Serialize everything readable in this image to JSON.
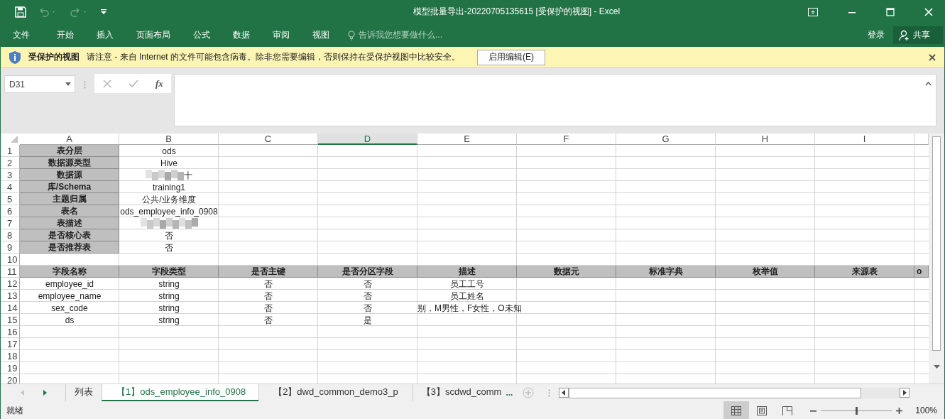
{
  "window": {
    "title": "模型批量导出-20220705135615  [受保护的视图] - Excel"
  },
  "ribbon": {
    "tabs": [
      {
        "label": "文件",
        "selected": false
      },
      {
        "label": "开始",
        "selected": false
      },
      {
        "label": "插入",
        "selected": false
      },
      {
        "label": "页面布局",
        "selected": false
      },
      {
        "label": "公式",
        "selected": false
      },
      {
        "label": "数据",
        "selected": false
      },
      {
        "label": "审阅",
        "selected": false
      },
      {
        "label": "视图",
        "selected": false
      }
    ],
    "tell_me": {
      "placeholder": "告诉我您想要做什么..."
    },
    "sign_in": "登录",
    "share": "共享"
  },
  "protected_bar": {
    "title": "受保护的视图",
    "message": "请注意 - 来自 Internet 的文件可能包含病毒。除非您需要编辑，否则保持在受保护视图中比较安全。",
    "button": "启用编辑(E)"
  },
  "formula_bar": {
    "name_box": "D31",
    "function_label": "fx"
  },
  "sheet": {
    "columns": [
      {
        "label": "A",
        "selected": false
      },
      {
        "label": "B",
        "selected": false
      },
      {
        "label": "C",
        "selected": false
      },
      {
        "label": "D",
        "selected": true
      },
      {
        "label": "E",
        "selected": false
      },
      {
        "label": "F",
        "selected": false
      },
      {
        "label": "G",
        "selected": false
      },
      {
        "label": "H",
        "selected": false
      },
      {
        "label": "I",
        "selected": false
      }
    ],
    "rows": [
      {
        "number": "1",
        "kind": "property",
        "cells": [
          "表分层",
          "ods"
        ]
      },
      {
        "number": "2",
        "kind": "property",
        "cells": [
          "数据源类型",
          "Hive"
        ]
      },
      {
        "number": "3",
        "kind": "property",
        "cells": [
          "数据源",
          {
            "kind": "blurred",
            "text": "十"
          }
        ]
      },
      {
        "number": "4",
        "kind": "property",
        "cells": [
          "库/Schema",
          "training1"
        ]
      },
      {
        "number": "5",
        "kind": "property",
        "cells": [
          "主题归属",
          "公共/业务维度"
        ]
      },
      {
        "number": "6",
        "kind": "property",
        "cells": [
          "表名",
          "ods_employee_info_0908"
        ]
      },
      {
        "number": "7",
        "kind": "property",
        "cells": [
          "表描述",
          {
            "kind": "blurred"
          }
        ]
      },
      {
        "number": "8",
        "kind": "property",
        "cells": [
          "是否核心表",
          "否"
        ]
      },
      {
        "number": "9",
        "kind": "property",
        "cells": [
          "是否推荐表",
          "否"
        ]
      },
      {
        "number": "10",
        "kind": "plain",
        "cells": []
      },
      {
        "number": "11",
        "kind": "header",
        "cells": [
          "字段名称",
          "字段类型",
          "是否主键",
          "是否分区字段",
          "描述",
          "数据元",
          "标准字典",
          "枚举值",
          "来源表",
          "o"
        ]
      },
      {
        "number": "12",
        "kind": "plain",
        "cells": [
          "employee_id",
          "string",
          "否",
          "否",
          "员工工号"
        ]
      },
      {
        "number": "13",
        "kind": "plain",
        "cells": [
          "employee_name",
          "string",
          "否",
          "否",
          "员工姓名"
        ]
      },
      {
        "number": "14",
        "kind": "plain",
        "cells": [
          "sex_code",
          "string",
          "否",
          "否",
          {
            "kind": "overflow",
            "text": "别，M男性，F女性，O未知"
          }
        ]
      },
      {
        "number": "15",
        "kind": "plain",
        "cells": [
          "ds",
          "string",
          "否",
          "是"
        ]
      },
      {
        "number": "16",
        "kind": "plain",
        "cells": []
      },
      {
        "number": "17",
        "kind": "plain",
        "cells": []
      },
      {
        "number": "18",
        "kind": "plain",
        "cells": []
      },
      {
        "number": "19",
        "kind": "plain",
        "cells": []
      },
      {
        "number": "20",
        "kind": "plain",
        "cells": []
      }
    ]
  },
  "sheet_tabs": [
    {
      "label": "列表",
      "selected": false
    },
    {
      "label": "【1】ods_employee_info_0908",
      "selected": true
    },
    {
      "label": "【2】dwd_common_demo3_p",
      "selected": false
    },
    {
      "label": "【3】scdwd_comm",
      "selected": false
    }
  ],
  "more_sheets": "...",
  "status_bar": {
    "status": "就绪",
    "views": [
      {
        "kind": "normal",
        "selected": true
      },
      {
        "kind": "layout",
        "selected": false
      },
      {
        "kind": "break",
        "selected": false
      }
    ],
    "zoom": {
      "level": 0.5,
      "reading": "100%"
    }
  }
}
